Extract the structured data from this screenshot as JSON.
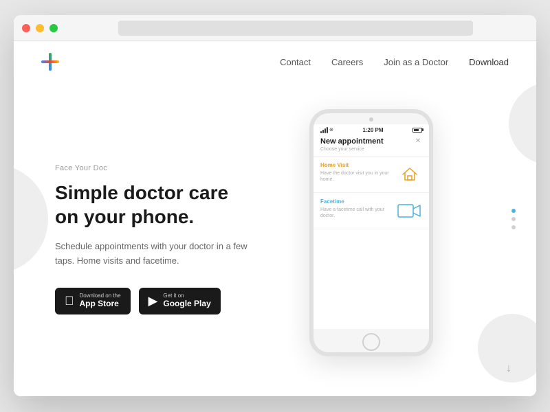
{
  "window": {
    "title": "Face Your Doc"
  },
  "navbar": {
    "logo_alt": "FaceYourDoc Logo",
    "links": [
      {
        "label": "Contact",
        "id": "contact"
      },
      {
        "label": "Careers",
        "id": "careers"
      },
      {
        "label": "Join as a Doctor",
        "id": "join"
      },
      {
        "label": "Download",
        "id": "download"
      }
    ]
  },
  "hero": {
    "eyebrow": "Face Your Doc",
    "title": "Simple doctor care on your phone.",
    "description": "Schedule appointments with your doctor in a few taps. Home visits and facetime.",
    "app_store_label": "Download on the",
    "app_store_name": "App Store",
    "google_play_label": "Get it on",
    "google_play_name": "Google Play"
  },
  "phone": {
    "status_time": "1:20 PM",
    "screen_title": "New appointment",
    "screen_subtitle": "Choose your service",
    "services": [
      {
        "name": "Home Visit",
        "description": "Have the doctor visit you in your home.",
        "color": "orange"
      },
      {
        "name": "Facetime",
        "description": "Have a facetime call with your doctor.",
        "color": "blue"
      }
    ]
  },
  "dot_nav": {
    "items": [
      {
        "active": true
      },
      {
        "active": false
      },
      {
        "active": false
      }
    ]
  },
  "colors": {
    "orange": "#e8a020",
    "blue": "#4ab3e0",
    "dark": "#1a1a1a",
    "gray": "#aaaaaa"
  }
}
